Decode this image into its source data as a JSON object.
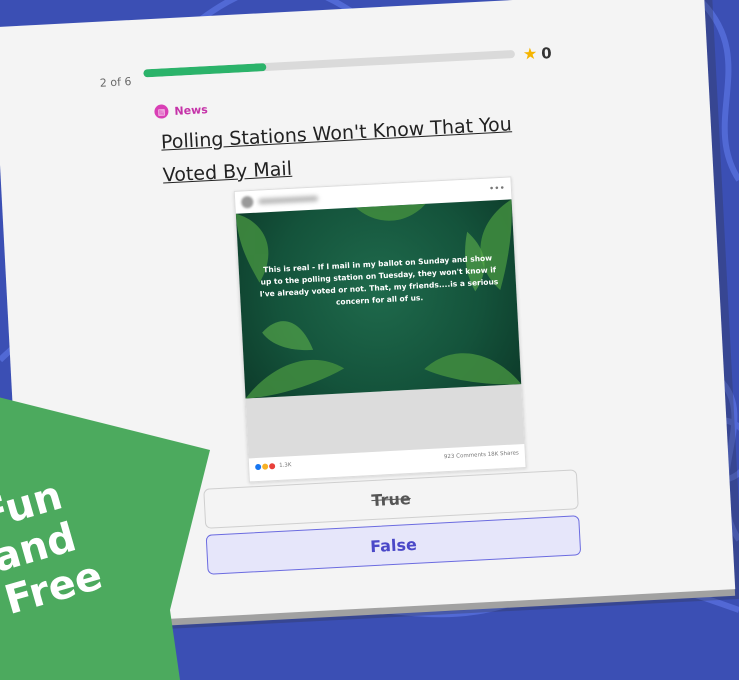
{
  "quiz": {
    "counter": "2 of 6",
    "progress_fraction": 0.33,
    "score": "0"
  },
  "question": {
    "category": "News",
    "title": "Polling Stations Won't Know That You Voted By Mail"
  },
  "post": {
    "image_text": "This is real - If I mail in my ballot on Sunday and show up to the polling station on Tuesday, they won't know if I've already voted or not. That, my friends....is a serious concern for all of us.",
    "reaction_count": "1.3K",
    "engagement": "923 Comments 18K Shares"
  },
  "answers": [
    {
      "label": "True"
    },
    {
      "label": "False"
    }
  ],
  "promo": {
    "line1": "Fun",
    "line2": "and",
    "line3": "Free"
  },
  "colors": {
    "background": "#3b4fb4",
    "progress": "#2bb36a",
    "category": "#c532a8",
    "false_accent": "#4a48c8",
    "ribbon": "#4caa5e"
  }
}
